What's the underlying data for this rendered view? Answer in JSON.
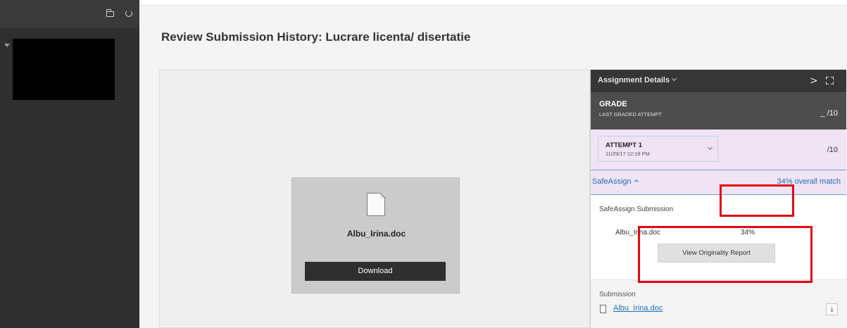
{
  "page": {
    "title": "Review Submission History: Lucrare licenta/ disertatie"
  },
  "sidebar": {
    "icons": [
      "folder-icon",
      "refresh-icon"
    ]
  },
  "viewer": {
    "file_name": "Albu_Irina.doc",
    "download_label": "Download"
  },
  "panel": {
    "header_title": "Assignment Details",
    "grade": {
      "label": "GRADE",
      "sublabel": "LAST GRADED ATTEMPT",
      "value": "_ /10"
    },
    "attempt": {
      "label": "ATTEMPT 1",
      "date": "11/29/17 12:19 PM",
      "grade": "/10"
    },
    "safeassign": {
      "toggle_label": "SafeAssign",
      "overall_match": "34% overall match",
      "section_title": "SafeAssign Submission",
      "file_name": "Albu_Irina.doc",
      "file_percent": "34%",
      "report_button": "View Originality Report"
    },
    "submission": {
      "title": "Submission",
      "file_link": "Albu_Irina.doc"
    }
  },
  "colors": {
    "sidebar": "#2f2f2f",
    "panel_header": "#363636",
    "attempt_bg": "#f0e3f4",
    "link": "#1f6fb2",
    "annotation": "#e30613"
  }
}
